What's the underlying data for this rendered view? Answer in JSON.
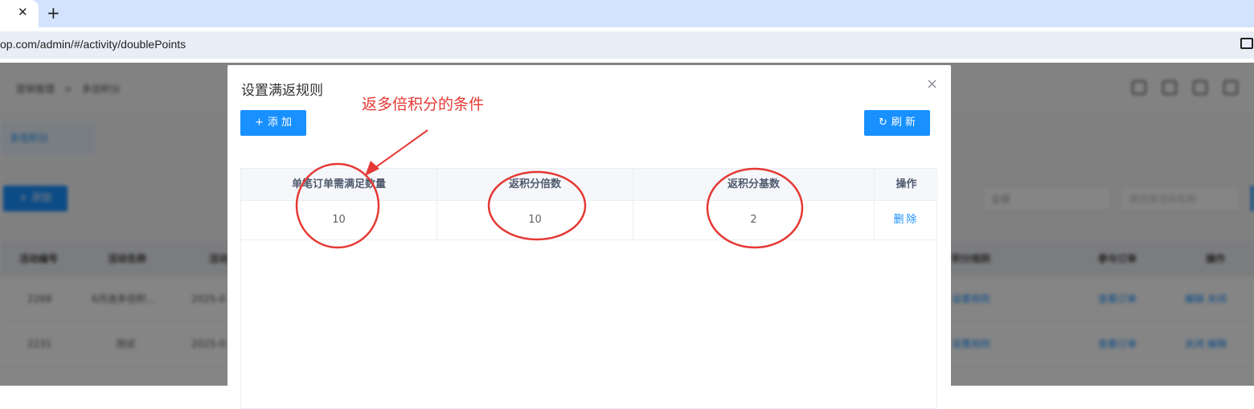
{
  "browser": {
    "tab_close_glyph": "✕",
    "new_tab_glyph": "+",
    "url": "op.com/admin/#/activity/doublePoints"
  },
  "dialog": {
    "title": "设置满返规则",
    "close_glyph": "×",
    "add_button": {
      "icon": "+",
      "label": "添 加"
    },
    "refresh_button": {
      "icon": "↻",
      "label": "刷 新"
    },
    "table": {
      "headers": [
        "单笔订单需满足数量",
        "返积分倍数",
        "返积分基数",
        "操作"
      ],
      "rows": [
        {
          "min_qty": "10",
          "multiplier": "10",
          "base": "2",
          "action": "删除"
        }
      ]
    }
  },
  "annotation": {
    "text": "返多倍积分的条件",
    "color": "#e53935"
  },
  "background_app": {
    "breadcrumb": [
      "营销管理",
      "多倍积分"
    ],
    "tab_label": "多倍积分",
    "add_label": "+ 添加",
    "select_value": "全部",
    "search_placeholder": "请选择活动名称",
    "headers": [
      "活动编号",
      "活动名称",
      "活动",
      "积分规则",
      "参与订单",
      "操作"
    ],
    "rows": [
      {
        "id": "2268",
        "name": "6月送多倍积...",
        "date": "2025-0",
        "rule": "设置规则",
        "orders": "查看订单",
        "ops": "编辑 关闭"
      },
      {
        "id": "2231",
        "name": "测试",
        "date": "2025-0",
        "rule": "设置规则",
        "orders": "查看订单",
        "ops": "关闭 编辑"
      }
    ]
  }
}
